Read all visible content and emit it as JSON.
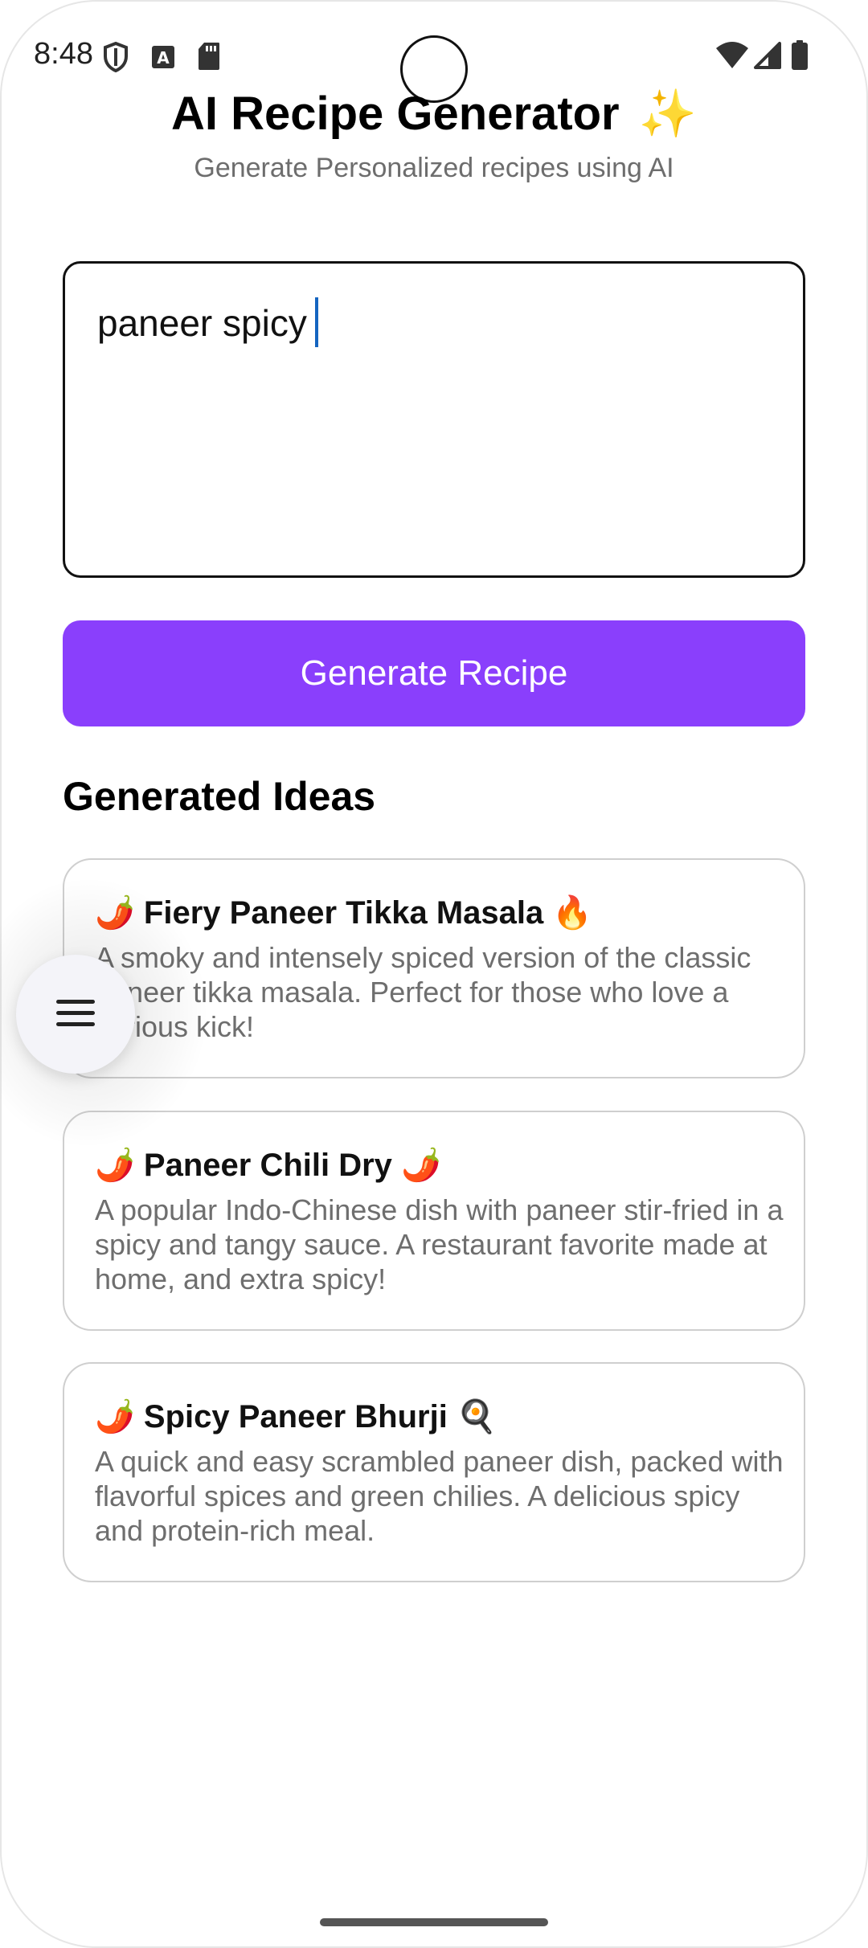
{
  "status_bar": {
    "time": "8:48",
    "icons": [
      "shield-icon",
      "text-recognition-icon",
      "sd-card-icon",
      "wifi-icon",
      "signal-icon",
      "battery-icon"
    ]
  },
  "header": {
    "title": "AI Recipe Generator",
    "title_emoji": "✨",
    "subtitle": "Generate Personalized recipes using AI"
  },
  "prompt": {
    "value": "paneer spicy"
  },
  "generate_button": {
    "label": "Generate Recipe"
  },
  "ideas": {
    "heading": "Generated Ideas",
    "items": [
      {
        "title": "🌶️ Fiery Paneer Tikka Masala 🔥",
        "description": "A smoky and intensely spiced version of the classic paneer tikka masala. Perfect for those who love a serious kick!"
      },
      {
        "title": "🌶️ Paneer Chili Dry 🌶️",
        "description": "A popular Indo-Chinese dish with paneer stir-fried in a spicy and tangy sauce.  A restaurant favorite made at home, and extra spicy!"
      },
      {
        "title": "🌶️ Spicy Paneer Bhurji 🍳",
        "description": "A quick and easy scrambled paneer dish, packed with flavorful spices and green chilies. A delicious spicy and protein-rich meal."
      }
    ]
  },
  "colors": {
    "accent": "#8a3ffc",
    "caret": "#1565c0",
    "muted_text": "#6e6e6e"
  }
}
